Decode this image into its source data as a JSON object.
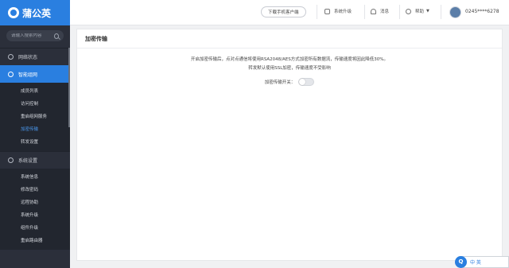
{
  "brand": {
    "name": "蒲公英"
  },
  "sidebar": {
    "search_placeholder": "请输入搜索内容",
    "groups": [
      {
        "label": "网络状态",
        "active": false
      },
      {
        "label": "智能组网",
        "active": true,
        "items": [
          "成员列表",
          "访问控制",
          "重启组网服务",
          "加密传输",
          "转发设置"
        ],
        "current": "加密传输"
      },
      {
        "label": "系统设置",
        "active": false,
        "items": [
          "系统信息",
          "修改密码",
          "远程协助",
          "系统升级",
          "组件升级",
          "重启路由器"
        ]
      }
    ]
  },
  "topbar": {
    "download_label": "下载手机客户端",
    "upgrade_label": "系统升级",
    "message_label": "消息",
    "help_label": "帮助",
    "user_label": "0245****6278"
  },
  "main": {
    "title": "加密传输",
    "desc_line1": "开启加密传输后，点对点通信将使用RSA2048/AES方式加密所有数据流，传输速度将因此降低30%。",
    "desc_line2": "转发默认使用SSL加密，传输速度不受影响",
    "toggle_label": "加密传输开关：",
    "toggle_on": false
  },
  "ime": {
    "logo": "Q",
    "mode": "中 英"
  },
  "colors": {
    "accent": "#2a7fe0",
    "sidebar_bg": "#2b2f3a"
  }
}
